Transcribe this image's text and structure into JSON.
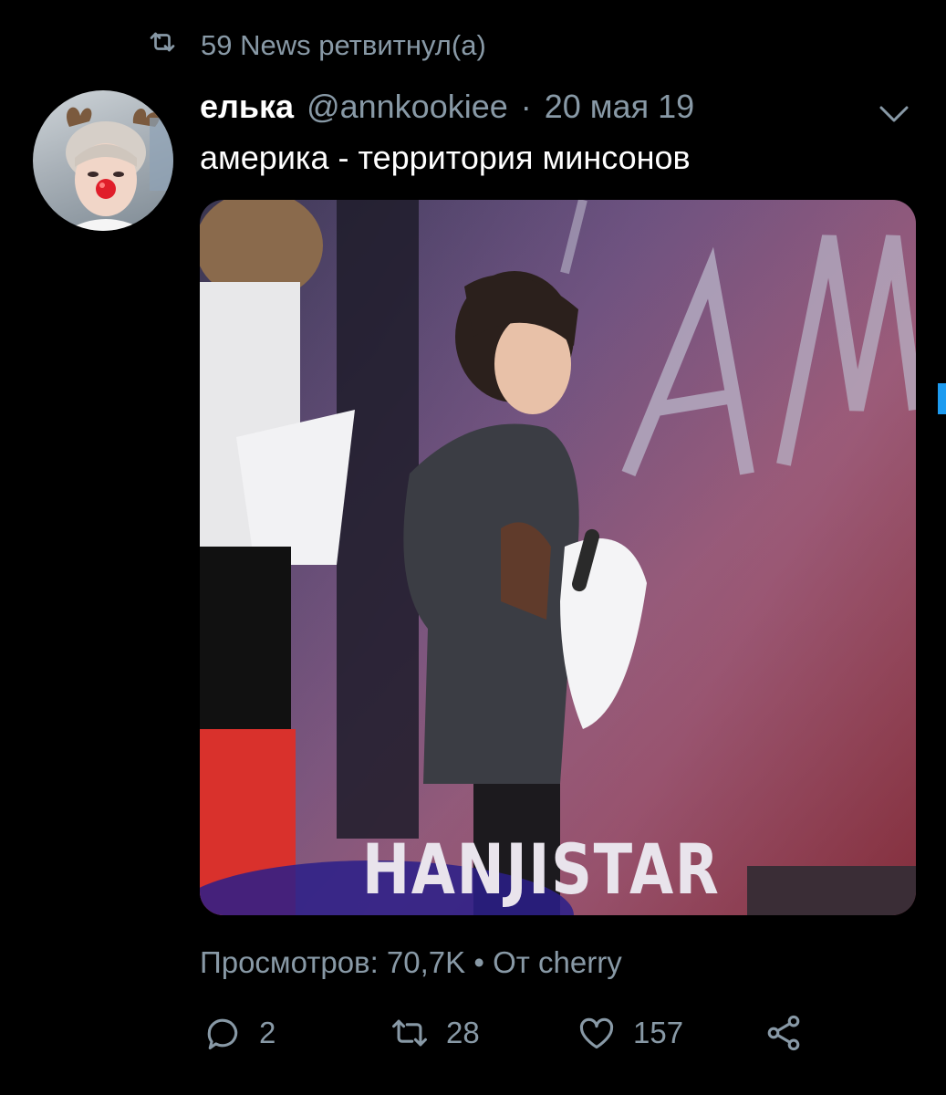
{
  "retweet": {
    "icon": "retweet-icon",
    "text": "59 News ретвитнул(а)"
  },
  "tweet": {
    "author_name": "елька",
    "author_handle": "@annkookiee",
    "separator": "·",
    "date": "20 мая 19",
    "text": "америка - территория минсонов",
    "menu_icon": "chevron-down-icon"
  },
  "media": {
    "watermark": "HANJISTAR"
  },
  "stats": {
    "views": "Просмотров: 70,7K",
    "bullet": "•",
    "source": "От cherry"
  },
  "actions": {
    "reply_count": "2",
    "retweet_count": "28",
    "like_count": "157"
  },
  "colors": {
    "background": "#000000",
    "text": "#ffffff",
    "secondary": "#8899a6",
    "accent": "#1d9bf0"
  }
}
